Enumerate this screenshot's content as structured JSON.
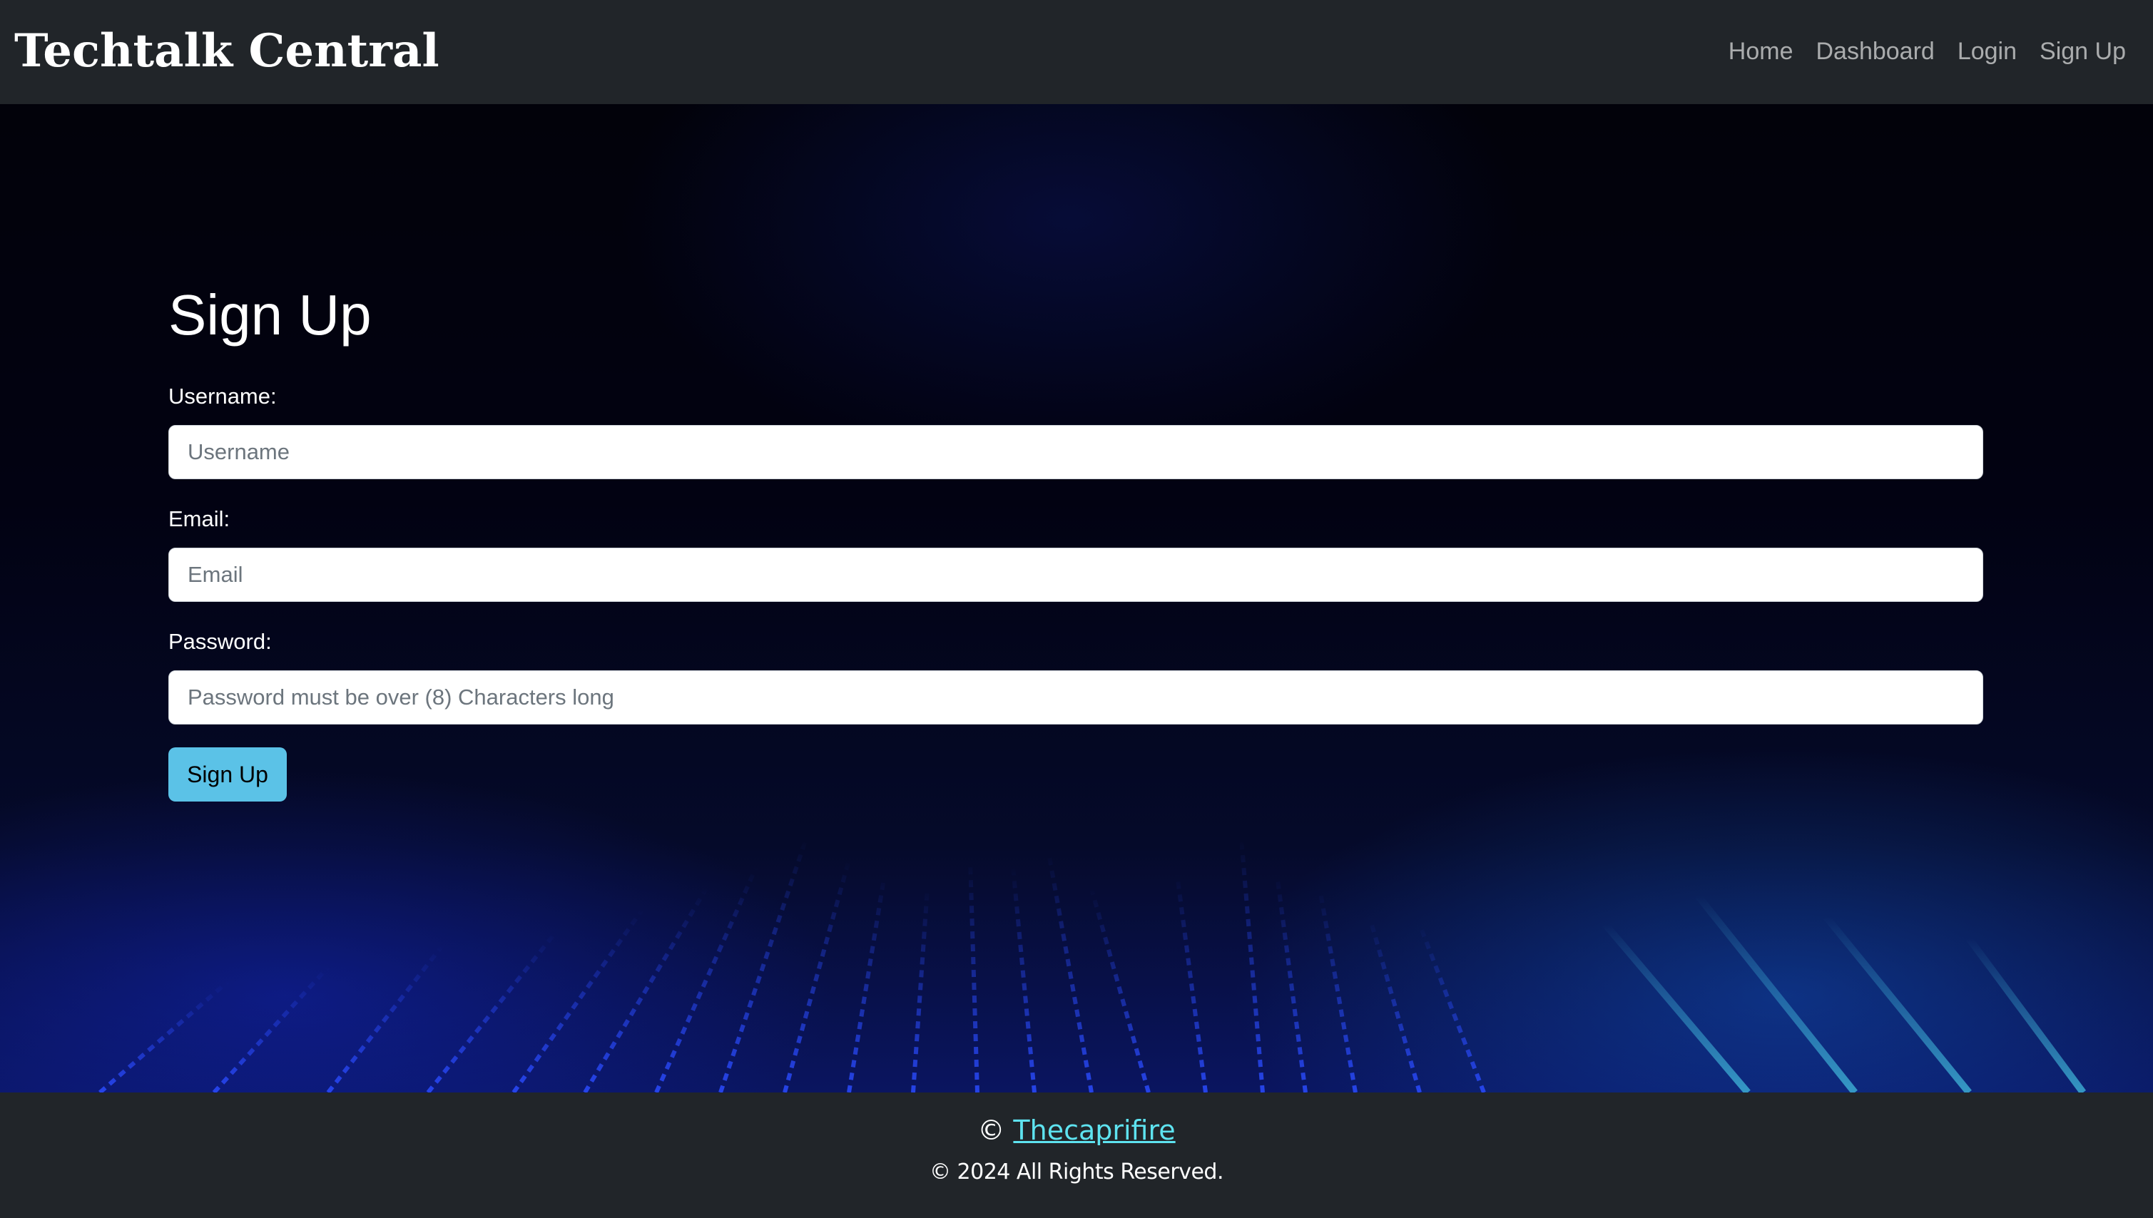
{
  "navbar": {
    "brand": "Techtalk Central",
    "links": [
      {
        "label": "Home"
      },
      {
        "label": "Dashboard"
      },
      {
        "label": "Login"
      },
      {
        "label": "Sign Up"
      }
    ]
  },
  "form": {
    "title": "Sign Up",
    "username": {
      "label": "Username:",
      "placeholder": "Username",
      "value": ""
    },
    "email": {
      "label": "Email:",
      "placeholder": "Email",
      "value": ""
    },
    "password": {
      "label": "Password:",
      "placeholder": "Password must be over (8) Characters long",
      "value": ""
    },
    "submit_label": "Sign Up"
  },
  "footer": {
    "copyright_symbol": "©",
    "author_link": "Thecaprifire",
    "rights": "© 2024 All Rights Reserved."
  },
  "colors": {
    "navbar_bg": "#212529",
    "button_bg": "#5bc2e7",
    "footer_link": "#5ee3f0"
  }
}
